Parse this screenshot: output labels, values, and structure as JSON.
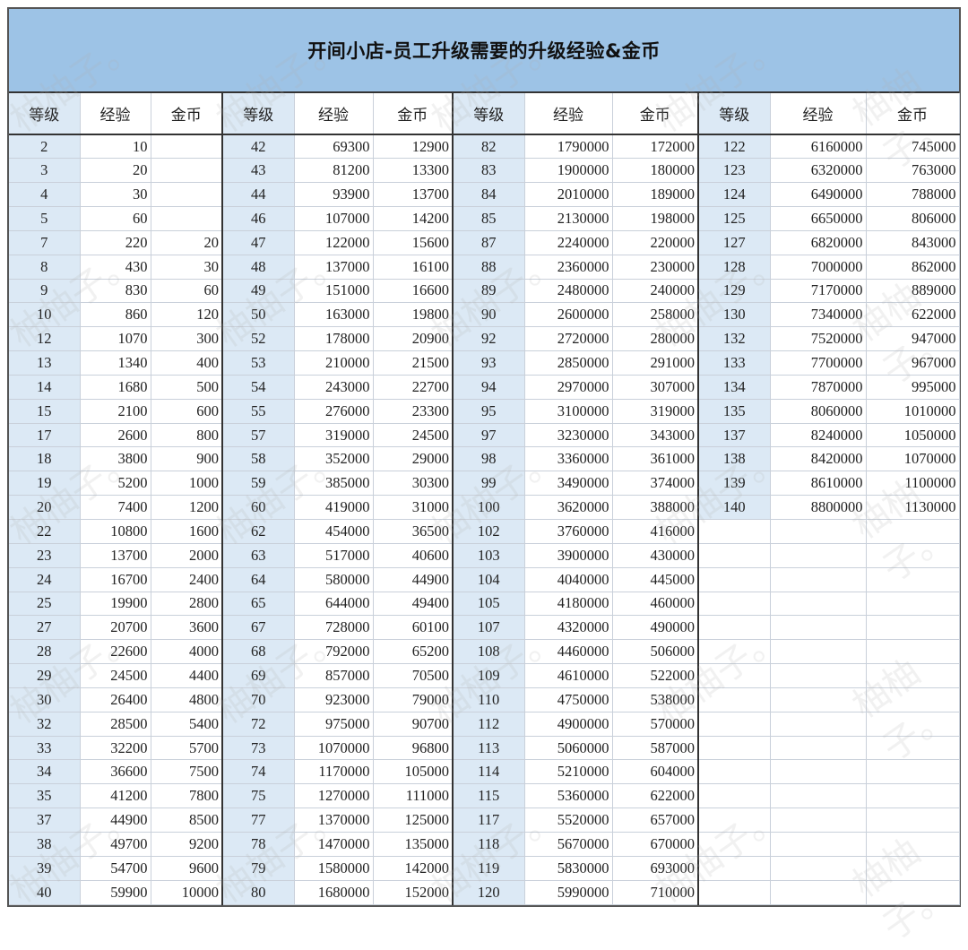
{
  "title": "开间小店-员工升级需要的升级经验&金币",
  "headers": [
    "等级",
    "经验",
    "金币"
  ],
  "groups": [
    [
      [
        "2",
        "10",
        ""
      ],
      [
        "3",
        "20",
        ""
      ],
      [
        "4",
        "30",
        ""
      ],
      [
        "5",
        "60",
        ""
      ],
      [
        "7",
        "220",
        "20"
      ],
      [
        "8",
        "430",
        "30"
      ],
      [
        "9",
        "830",
        "60"
      ],
      [
        "10",
        "860",
        "120"
      ],
      [
        "12",
        "1070",
        "300"
      ],
      [
        "13",
        "1340",
        "400"
      ],
      [
        "14",
        "1680",
        "500"
      ],
      [
        "15",
        "2100",
        "600"
      ],
      [
        "17",
        "2600",
        "800"
      ],
      [
        "18",
        "3800",
        "900"
      ],
      [
        "19",
        "5200",
        "1000"
      ],
      [
        "20",
        "7400",
        "1200"
      ],
      [
        "22",
        "10800",
        "1600"
      ],
      [
        "23",
        "13700",
        "2000"
      ],
      [
        "24",
        "16700",
        "2400"
      ],
      [
        "25",
        "19900",
        "2800"
      ],
      [
        "27",
        "20700",
        "3600"
      ],
      [
        "28",
        "22600",
        "4000"
      ],
      [
        "29",
        "24500",
        "4400"
      ],
      [
        "30",
        "26400",
        "4800"
      ],
      [
        "32",
        "28500",
        "5400"
      ],
      [
        "33",
        "32200",
        "5700"
      ],
      [
        "34",
        "36600",
        "7500"
      ],
      [
        "35",
        "41200",
        "7800"
      ],
      [
        "37",
        "44900",
        "8500"
      ],
      [
        "38",
        "49700",
        "9200"
      ],
      [
        "39",
        "54700",
        "9600"
      ],
      [
        "40",
        "59900",
        "10000"
      ]
    ],
    [
      [
        "42",
        "69300",
        "12900"
      ],
      [
        "43",
        "81200",
        "13300"
      ],
      [
        "44",
        "93900",
        "13700"
      ],
      [
        "46",
        "107000",
        "14200"
      ],
      [
        "47",
        "122000",
        "15600"
      ],
      [
        "48",
        "137000",
        "16100"
      ],
      [
        "49",
        "151000",
        "16600"
      ],
      [
        "50",
        "163000",
        "19800"
      ],
      [
        "52",
        "178000",
        "20900"
      ],
      [
        "53",
        "210000",
        "21500"
      ],
      [
        "54",
        "243000",
        "22700"
      ],
      [
        "55",
        "276000",
        "23300"
      ],
      [
        "57",
        "319000",
        "24500"
      ],
      [
        "58",
        "352000",
        "29000"
      ],
      [
        "59",
        "385000",
        "30300"
      ],
      [
        "60",
        "419000",
        "31000"
      ],
      [
        "62",
        "454000",
        "36500"
      ],
      [
        "63",
        "517000",
        "40600"
      ],
      [
        "64",
        "580000",
        "44900"
      ],
      [
        "65",
        "644000",
        "49400"
      ],
      [
        "67",
        "728000",
        "60100"
      ],
      [
        "68",
        "792000",
        "65200"
      ],
      [
        "69",
        "857000",
        "70500"
      ],
      [
        "70",
        "923000",
        "79000"
      ],
      [
        "72",
        "975000",
        "90700"
      ],
      [
        "73",
        "1070000",
        "96800"
      ],
      [
        "74",
        "1170000",
        "105000"
      ],
      [
        "75",
        "1270000",
        "111000"
      ],
      [
        "77",
        "1370000",
        "125000"
      ],
      [
        "78",
        "1470000",
        "135000"
      ],
      [
        "79",
        "1580000",
        "142000"
      ],
      [
        "80",
        "1680000",
        "152000"
      ]
    ],
    [
      [
        "82",
        "1790000",
        "172000"
      ],
      [
        "83",
        "1900000",
        "180000"
      ],
      [
        "84",
        "2010000",
        "189000"
      ],
      [
        "85",
        "2130000",
        "198000"
      ],
      [
        "87",
        "2240000",
        "220000"
      ],
      [
        "88",
        "2360000",
        "230000"
      ],
      [
        "89",
        "2480000",
        "240000"
      ],
      [
        "90",
        "2600000",
        "258000"
      ],
      [
        "92",
        "2720000",
        "280000"
      ],
      [
        "93",
        "2850000",
        "291000"
      ],
      [
        "94",
        "2970000",
        "307000"
      ],
      [
        "95",
        "3100000",
        "319000"
      ],
      [
        "97",
        "3230000",
        "343000"
      ],
      [
        "98",
        "3360000",
        "361000"
      ],
      [
        "99",
        "3490000",
        "374000"
      ],
      [
        "100",
        "3620000",
        "388000"
      ],
      [
        "102",
        "3760000",
        "416000"
      ],
      [
        "103",
        "3900000",
        "430000"
      ],
      [
        "104",
        "4040000",
        "445000"
      ],
      [
        "105",
        "4180000",
        "460000"
      ],
      [
        "107",
        "4320000",
        "490000"
      ],
      [
        "108",
        "4460000",
        "506000"
      ],
      [
        "109",
        "4610000",
        "522000"
      ],
      [
        "110",
        "4750000",
        "538000"
      ],
      [
        "112",
        "4900000",
        "570000"
      ],
      [
        "113",
        "5060000",
        "587000"
      ],
      [
        "114",
        "5210000",
        "604000"
      ],
      [
        "115",
        "5360000",
        "622000"
      ],
      [
        "117",
        "5520000",
        "657000"
      ],
      [
        "118",
        "5670000",
        "670000"
      ],
      [
        "119",
        "5830000",
        "693000"
      ],
      [
        "120",
        "5990000",
        "710000"
      ]
    ],
    [
      [
        "122",
        "6160000",
        "745000"
      ],
      [
        "123",
        "6320000",
        "763000"
      ],
      [
        "124",
        "6490000",
        "788000"
      ],
      [
        "125",
        "6650000",
        "806000"
      ],
      [
        "127",
        "6820000",
        "843000"
      ],
      [
        "128",
        "7000000",
        "862000"
      ],
      [
        "129",
        "7170000",
        "889000"
      ],
      [
        "130",
        "7340000",
        "622000"
      ],
      [
        "132",
        "7520000",
        "947000"
      ],
      [
        "133",
        "7700000",
        "967000"
      ],
      [
        "134",
        "7870000",
        "995000"
      ],
      [
        "135",
        "8060000",
        "1010000"
      ],
      [
        "137",
        "8240000",
        "1050000"
      ],
      [
        "138",
        "8420000",
        "1070000"
      ],
      [
        "139",
        "8610000",
        "1100000"
      ],
      [
        "140",
        "8800000",
        "1130000"
      ]
    ]
  ],
  "watermark": "柚柚子。",
  "colors": {
    "title_bg": "#9dc3e6",
    "level_bg": "#dce9f5"
  }
}
